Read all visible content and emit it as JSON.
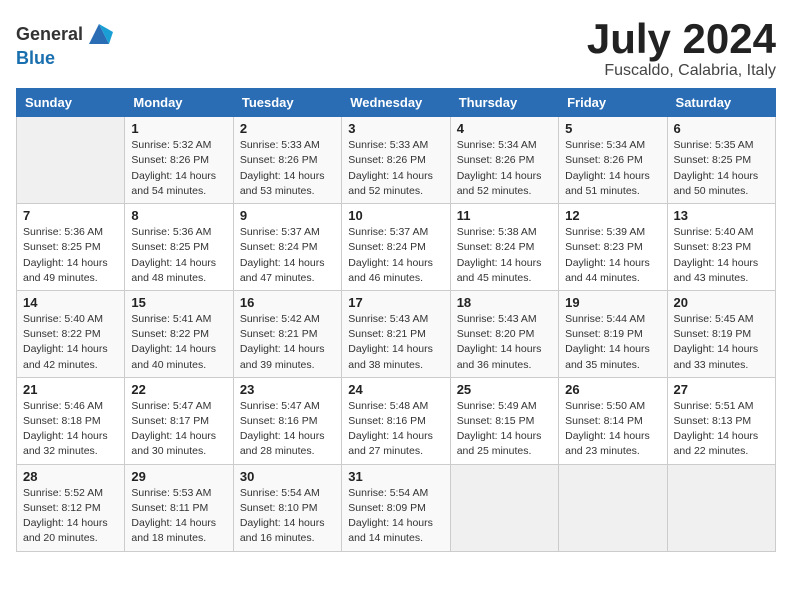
{
  "logo": {
    "text_general": "General",
    "text_blue": "Blue"
  },
  "title": {
    "month_year": "July 2024",
    "location": "Fuscaldo, Calabria, Italy"
  },
  "days_of_week": [
    "Sunday",
    "Monday",
    "Tuesday",
    "Wednesday",
    "Thursday",
    "Friday",
    "Saturday"
  ],
  "weeks": [
    [
      {
        "day": "",
        "info": ""
      },
      {
        "day": "1",
        "info": "Sunrise: 5:32 AM\nSunset: 8:26 PM\nDaylight: 14 hours\nand 54 minutes."
      },
      {
        "day": "2",
        "info": "Sunrise: 5:33 AM\nSunset: 8:26 PM\nDaylight: 14 hours\nand 53 minutes."
      },
      {
        "day": "3",
        "info": "Sunrise: 5:33 AM\nSunset: 8:26 PM\nDaylight: 14 hours\nand 52 minutes."
      },
      {
        "day": "4",
        "info": "Sunrise: 5:34 AM\nSunset: 8:26 PM\nDaylight: 14 hours\nand 52 minutes."
      },
      {
        "day": "5",
        "info": "Sunrise: 5:34 AM\nSunset: 8:26 PM\nDaylight: 14 hours\nand 51 minutes."
      },
      {
        "day": "6",
        "info": "Sunrise: 5:35 AM\nSunset: 8:25 PM\nDaylight: 14 hours\nand 50 minutes."
      }
    ],
    [
      {
        "day": "7",
        "info": "Sunrise: 5:36 AM\nSunset: 8:25 PM\nDaylight: 14 hours\nand 49 minutes."
      },
      {
        "day": "8",
        "info": "Sunrise: 5:36 AM\nSunset: 8:25 PM\nDaylight: 14 hours\nand 48 minutes."
      },
      {
        "day": "9",
        "info": "Sunrise: 5:37 AM\nSunset: 8:24 PM\nDaylight: 14 hours\nand 47 minutes."
      },
      {
        "day": "10",
        "info": "Sunrise: 5:37 AM\nSunset: 8:24 PM\nDaylight: 14 hours\nand 46 minutes."
      },
      {
        "day": "11",
        "info": "Sunrise: 5:38 AM\nSunset: 8:24 PM\nDaylight: 14 hours\nand 45 minutes."
      },
      {
        "day": "12",
        "info": "Sunrise: 5:39 AM\nSunset: 8:23 PM\nDaylight: 14 hours\nand 44 minutes."
      },
      {
        "day": "13",
        "info": "Sunrise: 5:40 AM\nSunset: 8:23 PM\nDaylight: 14 hours\nand 43 minutes."
      }
    ],
    [
      {
        "day": "14",
        "info": "Sunrise: 5:40 AM\nSunset: 8:22 PM\nDaylight: 14 hours\nand 42 minutes."
      },
      {
        "day": "15",
        "info": "Sunrise: 5:41 AM\nSunset: 8:22 PM\nDaylight: 14 hours\nand 40 minutes."
      },
      {
        "day": "16",
        "info": "Sunrise: 5:42 AM\nSunset: 8:21 PM\nDaylight: 14 hours\nand 39 minutes."
      },
      {
        "day": "17",
        "info": "Sunrise: 5:43 AM\nSunset: 8:21 PM\nDaylight: 14 hours\nand 38 minutes."
      },
      {
        "day": "18",
        "info": "Sunrise: 5:43 AM\nSunset: 8:20 PM\nDaylight: 14 hours\nand 36 minutes."
      },
      {
        "day": "19",
        "info": "Sunrise: 5:44 AM\nSunset: 8:19 PM\nDaylight: 14 hours\nand 35 minutes."
      },
      {
        "day": "20",
        "info": "Sunrise: 5:45 AM\nSunset: 8:19 PM\nDaylight: 14 hours\nand 33 minutes."
      }
    ],
    [
      {
        "day": "21",
        "info": "Sunrise: 5:46 AM\nSunset: 8:18 PM\nDaylight: 14 hours\nand 32 minutes."
      },
      {
        "day": "22",
        "info": "Sunrise: 5:47 AM\nSunset: 8:17 PM\nDaylight: 14 hours\nand 30 minutes."
      },
      {
        "day": "23",
        "info": "Sunrise: 5:47 AM\nSunset: 8:16 PM\nDaylight: 14 hours\nand 28 minutes."
      },
      {
        "day": "24",
        "info": "Sunrise: 5:48 AM\nSunset: 8:16 PM\nDaylight: 14 hours\nand 27 minutes."
      },
      {
        "day": "25",
        "info": "Sunrise: 5:49 AM\nSunset: 8:15 PM\nDaylight: 14 hours\nand 25 minutes."
      },
      {
        "day": "26",
        "info": "Sunrise: 5:50 AM\nSunset: 8:14 PM\nDaylight: 14 hours\nand 23 minutes."
      },
      {
        "day": "27",
        "info": "Sunrise: 5:51 AM\nSunset: 8:13 PM\nDaylight: 14 hours\nand 22 minutes."
      }
    ],
    [
      {
        "day": "28",
        "info": "Sunrise: 5:52 AM\nSunset: 8:12 PM\nDaylight: 14 hours\nand 20 minutes."
      },
      {
        "day": "29",
        "info": "Sunrise: 5:53 AM\nSunset: 8:11 PM\nDaylight: 14 hours\nand 18 minutes."
      },
      {
        "day": "30",
        "info": "Sunrise: 5:54 AM\nSunset: 8:10 PM\nDaylight: 14 hours\nand 16 minutes."
      },
      {
        "day": "31",
        "info": "Sunrise: 5:54 AM\nSunset: 8:09 PM\nDaylight: 14 hours\nand 14 minutes."
      },
      {
        "day": "",
        "info": ""
      },
      {
        "day": "",
        "info": ""
      },
      {
        "day": "",
        "info": ""
      }
    ]
  ]
}
